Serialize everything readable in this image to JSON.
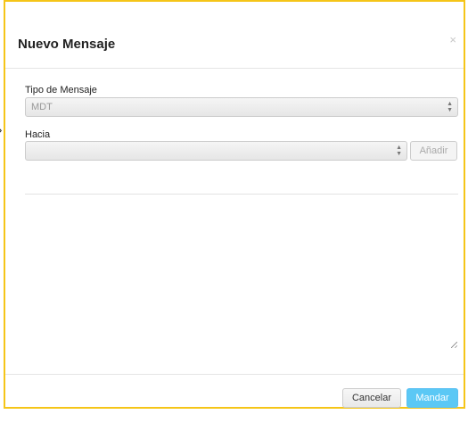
{
  "modal": {
    "title": "Nuevo Mensaje",
    "close_label": "×"
  },
  "form": {
    "message_type": {
      "label": "Tipo de Mensaje",
      "selected": "MDT"
    },
    "to": {
      "label": "Hacia",
      "selected": "",
      "add_label": "Añadir"
    },
    "message": {
      "value": ""
    }
  },
  "footer": {
    "cancel_label": "Cancelar",
    "send_label": "Mandar"
  },
  "icons": {
    "select_arrows": "updown-arrows-icon",
    "close": "close-icon",
    "resize": "resize-handle-icon"
  },
  "colors": {
    "modal_border": "#f5c518",
    "send_button": "#5bc8f5"
  }
}
